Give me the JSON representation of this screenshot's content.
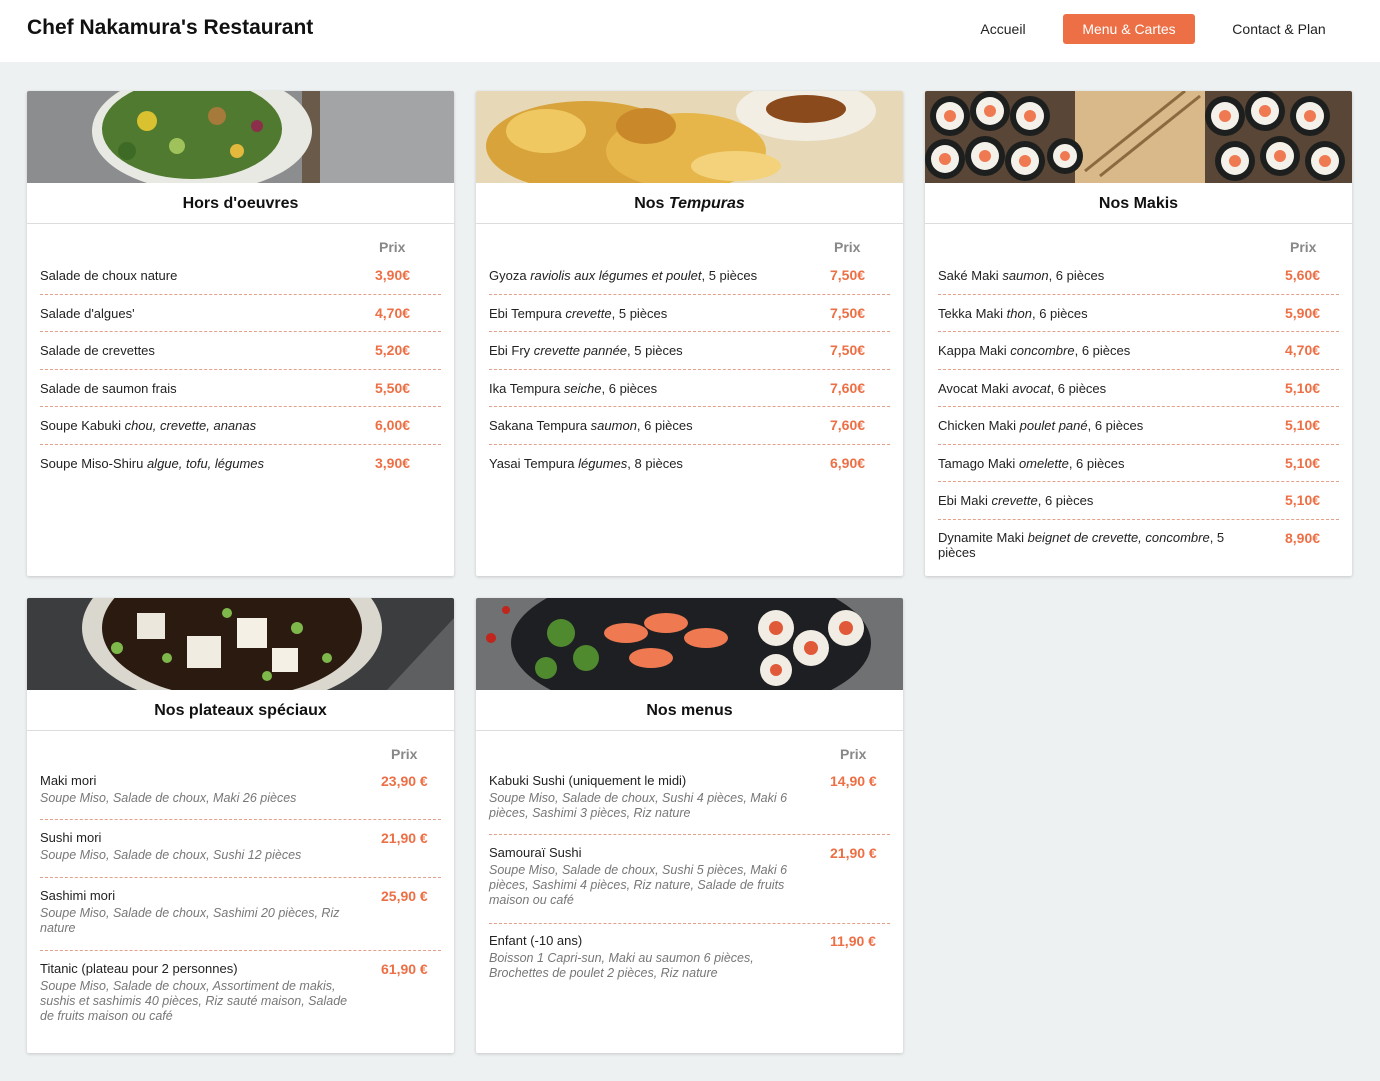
{
  "header": {
    "brand": "Chef Nakamura's Restaurant",
    "nav": [
      "Accueil",
      "Menu & Cartes",
      "Contact & Plan"
    ]
  },
  "colors": {
    "accent": "#ec6f45",
    "page_bg": "#eef1f2"
  },
  "price_header": "Prix",
  "cards": {
    "hors": {
      "title": "Hors d'oeuvres",
      "items": [
        {
          "name": "Salade de choux nature",
          "price": "3,90€"
        },
        {
          "name": "Salade d'algues'",
          "price": "4,70€"
        },
        {
          "name": "Salade de crevettes",
          "price": "5,20€"
        },
        {
          "name": "Salade de saumon frais",
          "price": "5,50€"
        },
        {
          "name": "Soupe Kabuki",
          "desc": "chou, crevette, ananas",
          "price": "6,00€"
        },
        {
          "name": "Soupe Miso-Shiru",
          "desc": "algue, tofu, légumes",
          "price": "3,90€"
        }
      ]
    },
    "tempura": {
      "title_prefix": "Nos ",
      "title_em": "Tempuras",
      "items": [
        {
          "name": "Gyoza",
          "desc": "raviolis aux légumes et poulet",
          "qty": ", 5 pièces",
          "price": "7,50€"
        },
        {
          "name": "Ebi Tempura",
          "desc": "crevette",
          "qty": ", 5 pièces",
          "price": "7,50€"
        },
        {
          "name": "Ebi Fry",
          "desc": "crevette pannée",
          "qty": ", 5 pièces",
          "price": "7,50€"
        },
        {
          "name": "Ika Tempura",
          "desc": "seiche",
          "qty": ", 6 pièces",
          "price": "7,60€"
        },
        {
          "name": "Sakana Tempura",
          "desc": "saumon",
          "qty": ", 6 pièces",
          "price": "7,60€"
        },
        {
          "name": "Yasai Tempura",
          "desc": "légumes",
          "qty": ", 8 pièces",
          "price": "6,90€"
        }
      ]
    },
    "makis": {
      "title": "Nos Makis",
      "items": [
        {
          "name": "Saké Maki",
          "desc": "saumon",
          "qty": ", 6 pièces",
          "price": "5,60€"
        },
        {
          "name": "Tekka Maki",
          "desc": "thon",
          "qty": ", 6 pièces",
          "price": "5,90€"
        },
        {
          "name": "Kappa Maki",
          "desc": "concombre",
          "qty": ", 6 pièces",
          "price": "4,70€"
        },
        {
          "name": "Avocat Maki",
          "desc": "avocat",
          "qty": ", 6 pièces",
          "price": "5,10€"
        },
        {
          "name": "Chicken Maki",
          "desc": "poulet pané",
          "qty": ", 6 pièces",
          "price": "5,10€"
        },
        {
          "name": "Tamago Maki",
          "desc": "omelette",
          "qty": ", 6 pièces",
          "price": "5,10€"
        },
        {
          "name": "Ebi Maki",
          "desc": "crevette",
          "qty": ", 6 pièces",
          "price": "5,10€"
        },
        {
          "name": "Dynamite Maki",
          "desc": "beignet de crevette, concombre",
          "qty": ", 5 pièces",
          "price": "8,90€"
        }
      ]
    },
    "plateaux": {
      "title": "Nos plateaux spéciaux",
      "items": [
        {
          "name": "Maki mori",
          "desc": "Soupe Miso, Salade de choux, Maki 26 pièces",
          "price": "23,90 €"
        },
        {
          "name": "Sushi mori",
          "desc": "Soupe Miso, Salade de choux, Sushi 12 pièces",
          "price": "21,90 €"
        },
        {
          "name": "Sashimi mori",
          "desc": "Soupe Miso, Salade de choux, Sashimi 20 pièces, Riz nature",
          "price": "25,90 €"
        },
        {
          "name": "Titanic (plateau pour 2 personnes)",
          "desc": "Soupe Miso, Salade de choux, Assortiment de makis, sushis et sashimis 40 pièces, Riz sauté maison, Salade de fruits maison ou café",
          "price": "61,90 €"
        }
      ]
    },
    "menus": {
      "title": "Nos menus",
      "items": [
        {
          "name": "Kabuki Sushi (uniquement le midi)",
          "desc": "Soupe Miso, Salade de choux, Sushi 4 pièces, Maki 6 pièces, Sashimi 3 pièces, Riz nature",
          "price": "14,90 €"
        },
        {
          "name": "Samouraï Sushi",
          "desc": "Soupe Miso, Salade de choux, Sushi 5 pièces, Maki 6 pièces, Sashimi 4 pièces, Riz nature, Salade de fruits maison ou café",
          "price": "21,90 €"
        },
        {
          "name": "Enfant (-10 ans)",
          "desc": "Boisson 1 Capri-sun, Maki au saumon 6 pièces, Brochettes de poulet 2 pièces, Riz nature",
          "price": "11,90 €"
        }
      ]
    }
  }
}
